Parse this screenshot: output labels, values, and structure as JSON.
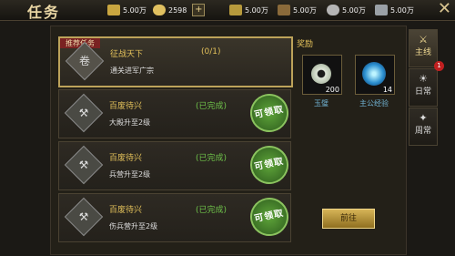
{
  "window": {
    "title": "任务"
  },
  "resources": [
    {
      "icon": "gold-bar-icon",
      "value": "5.00万"
    },
    {
      "icon": "ingot-icon",
      "value": "2598"
    },
    {
      "icon": "grain-icon",
      "value": "5.00万"
    },
    {
      "icon": "wood-icon",
      "value": "5.00万"
    },
    {
      "icon": "stone-icon",
      "value": "5.00万"
    },
    {
      "icon": "iron-icon",
      "value": "5.00万"
    }
  ],
  "tasks": [
    {
      "tag": "推荐任务",
      "name": "征战天下",
      "progress": "(0/1)",
      "desc": "通关进军广宗",
      "icon": "scroll-icon",
      "selected": true
    },
    {
      "name": "百废待兴",
      "status": "(已完成)",
      "desc": "大殿升至2级",
      "claim": "可领取",
      "icon": "hammer-icon"
    },
    {
      "name": "百废待兴",
      "status": "(已完成)",
      "desc": "兵营升至2级",
      "claim": "可领取",
      "icon": "hammer-icon"
    },
    {
      "name": "百废待兴",
      "status": "(已完成)",
      "desc": "伤兵营升至2级",
      "claim": "可领取",
      "icon": "hammer-icon"
    }
  ],
  "rewards": {
    "title": "奖励",
    "items": [
      {
        "name": "玉璧",
        "count": "200",
        "icon": "jade-disc-icon"
      },
      {
        "name": "主公经验",
        "count": "14",
        "icon": "exp-orb-icon"
      }
    ],
    "go_label": "前往"
  },
  "side_tabs": [
    {
      "label": "主线",
      "icon": "main-quest-icon",
      "active": true
    },
    {
      "label": "日常",
      "icon": "daily-icon",
      "badge": "1"
    },
    {
      "label": "周常",
      "icon": "weekly-icon"
    }
  ]
}
